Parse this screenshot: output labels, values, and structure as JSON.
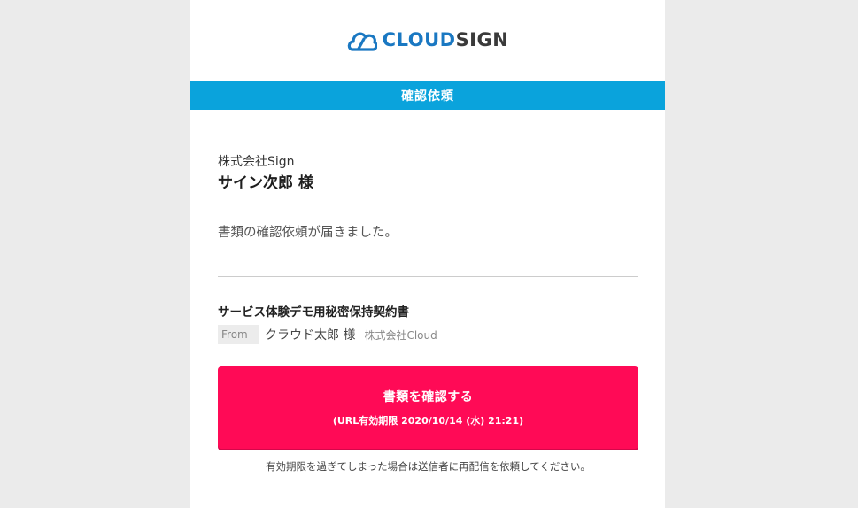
{
  "logo": {
    "cloud_text": "CLOUD",
    "sign_text": "SIGN",
    "icon": "cloudsign-logo-icon"
  },
  "banner": {
    "title": "確認依頼"
  },
  "greeting": {
    "company": "株式会社Sign",
    "recipient": "サイン次郎 様"
  },
  "message": "書類の確認依頼が届きました。",
  "document": {
    "title": "サービス体験デモ用秘密保持契約書",
    "from_label": "From",
    "sender_name": "クラウド太郎 様",
    "sender_company": "株式会社Cloud"
  },
  "cta": {
    "label": "書類を確認する",
    "expiry": "(URL有効期限 2020/10/14 (水) 21:21)"
  },
  "note": "有効期限を過ぎてしまった場合は送信者に再配信を依頼してください。",
  "colors": {
    "background": "#ebebeb",
    "banner": "#0aa3dc",
    "button": "#ff0a56",
    "logo_blue": "#1a78c2"
  }
}
